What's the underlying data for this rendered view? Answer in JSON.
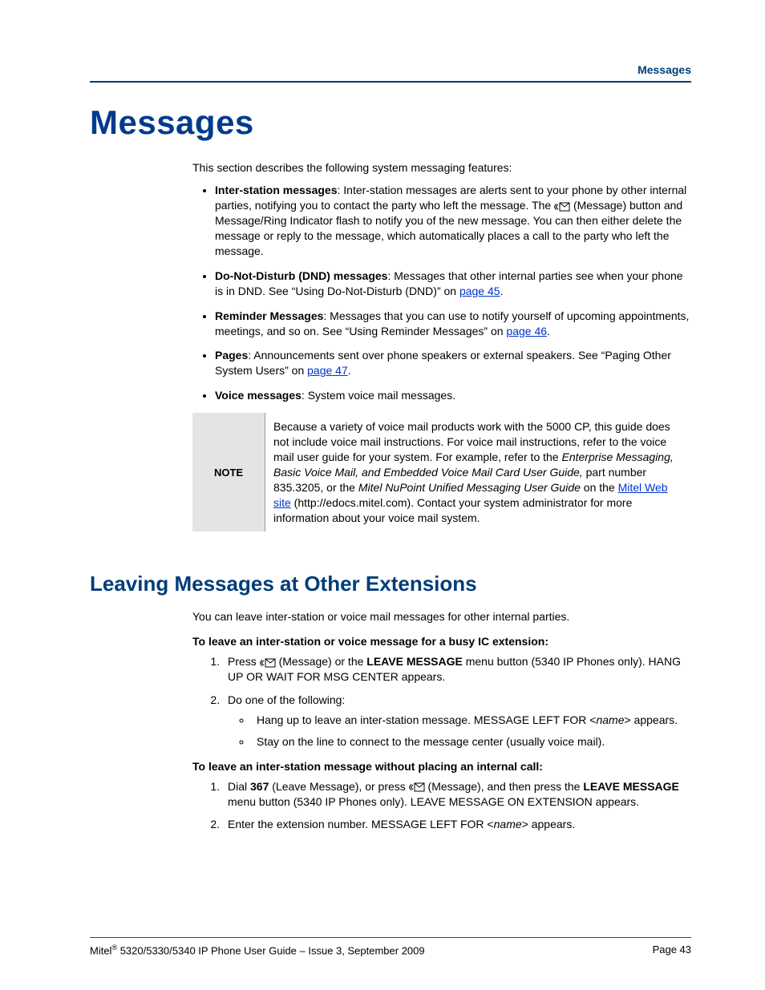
{
  "header": {
    "section_label": "Messages"
  },
  "title": "Messages",
  "intro": "This section describes the following system messaging features:",
  "bullets": {
    "b1": {
      "term": "Inter-station messages",
      "t1": ": Inter-station messages are alerts sent to your phone by other internal parties, notifying you to contact the party who left the message. The ",
      "t2": " (Message) button and Message/Ring Indicator flash to notify you of the new message. You can then either delete the message or reply to the message, which automatically places a call to the party who left the message."
    },
    "b2": {
      "term": "Do-Not-Disturb (DND) messages",
      "t1": ": Messages that other internal parties see when your phone is in DND. See “Using Do-Not-Disturb (DND)” on ",
      "link": "page 45",
      "t2": "."
    },
    "b3": {
      "term": "Reminder Messages",
      "t1": ": Messages that you can use to notify yourself of upcoming appointments, meetings, and so on. See “Using Reminder Messages” on ",
      "link": "page 46",
      "t2": "."
    },
    "b4": {
      "term": "Pages",
      "t1": ": Announcements sent over phone speakers or external speakers. See “Paging Other System Users” on ",
      "link": "page 47",
      "t2": "."
    },
    "b5": {
      "term": "Voice messages",
      "t1": ": System voice mail messages."
    }
  },
  "note": {
    "label": "NOTE",
    "p1": "Because a variety of voice mail products work with the 5000 CP, this guide does not include voice mail instructions. For voice mail instructions, refer to the voice mail user guide for your system. For example, refer to the ",
    "i1": "Enterprise Messaging, Basic Voice Mail, and Embedded Voice Mail Card User Guide,",
    "p2": " part number 835.3205, or the ",
    "i2": "Mitel NuPoint Unified Messaging User Guide",
    "p3": " on the ",
    "link": "Mitel Web site",
    "p4": " (http://edocs.mitel.com). Contact your system administrator for more information about your voice mail system."
  },
  "sub": {
    "heading": "Leaving Messages at Other Extensions",
    "intro": "You can leave inter-station or voice mail messages for other internal parties.",
    "proc1": {
      "title": "To leave an inter-station or voice message for a busy IC extension:",
      "s1a": "Press ",
      "s1b": " (Message) or the ",
      "s1bold": "LEAVE MESSAGE",
      "s1c": " menu button (5340 IP Phones only). HANG UP OR WAIT FOR MSG CENTER appears.",
      "s2": "Do one of the following:",
      "s2a_a": "Hang up to leave an inter-station message. MESSAGE LEFT FOR <",
      "s2a_i": "name",
      "s2a_b": "> appears.",
      "s2b": "Stay on the line to connect to the message center (usually voice mail)."
    },
    "proc2": {
      "title": "To leave an inter-station message without placing an internal call:",
      "s1a": "Dial ",
      "s1num": "367",
      "s1b": " (Leave Message), or press ",
      "s1c": " (Message), and then press the ",
      "s1bold": "LEAVE MESSAGE",
      "s1d": " menu button (5340 IP Phones only). LEAVE MESSAGE ON EXTENSION appears.",
      "s2a": "Enter the extension number. MESSAGE LEFT FOR <",
      "s2i": "name",
      "s2b": "> appears."
    }
  },
  "footer": {
    "left_a": "Mitel",
    "left_sup": "®",
    "left_b": " 5320/5330/5340 IP Phone User Guide – Issue 3, September 2009",
    "right": "Page 43"
  }
}
